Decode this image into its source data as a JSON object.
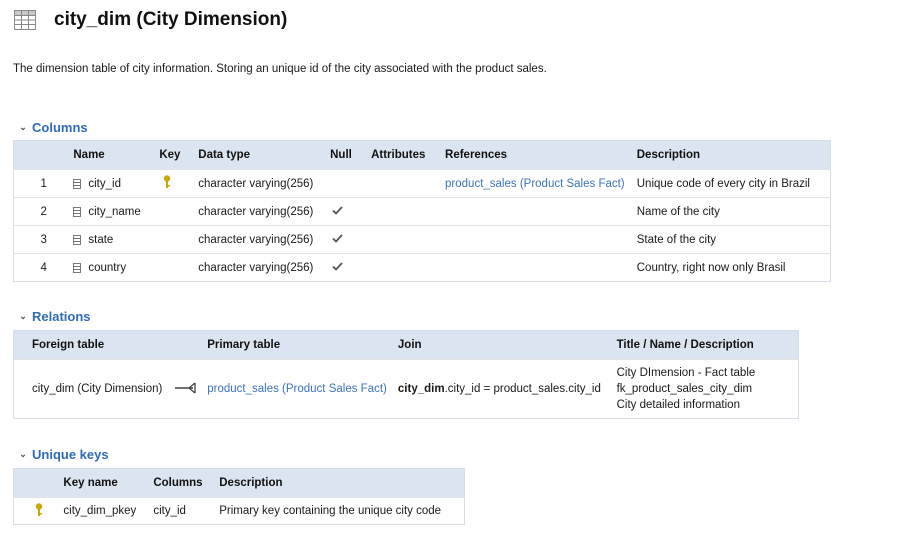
{
  "header": {
    "title": "city_dim (City Dimension)"
  },
  "description": "The dimension table of city information. Storing an unique id of the city associated with the product sales.",
  "columns_section": {
    "title": "Columns",
    "headers": {
      "name": "Name",
      "key": "Key",
      "data_type": "Data type",
      "null": "Null",
      "attributes": "Attributes",
      "references": "References",
      "description": "Description"
    },
    "rows": [
      {
        "num": "1",
        "name": "city_id",
        "key": true,
        "data_type": "character varying(256)",
        "null": false,
        "attributes": "",
        "references": "product_sales (Product Sales Fact)",
        "description": "Unique code of every city in Brazil"
      },
      {
        "num": "2",
        "name": "city_name",
        "key": false,
        "data_type": "character varying(256)",
        "null": true,
        "attributes": "",
        "references": "",
        "description": "Name of the city"
      },
      {
        "num": "3",
        "name": "state",
        "key": false,
        "data_type": "character varying(256)",
        "null": true,
        "attributes": "",
        "references": "",
        "description": "State of the city"
      },
      {
        "num": "4",
        "name": "country",
        "key": false,
        "data_type": "character varying(256)",
        "null": true,
        "attributes": "",
        "references": "",
        "description": "Country, right now only Brasil"
      }
    ]
  },
  "relations_section": {
    "title": "Relations",
    "headers": {
      "foreign_table": "Foreign table",
      "primary_table": "Primary table",
      "join": "Join",
      "title_desc": "Title / Name / Description"
    },
    "rows": [
      {
        "foreign_table": "city_dim (City Dimension)",
        "primary_table": "product_sales (Product Sales Fact)",
        "join_bold": "city_dim",
        "join_rest": ".city_id = product_sales.city_id",
        "title": "City DImension - Fact table",
        "name": "fk_product_sales_city_dim",
        "description": "City detailed information"
      }
    ]
  },
  "unique_keys_section": {
    "title": "Unique keys",
    "headers": {
      "key_name": "Key name",
      "columns": "Columns",
      "description": "Description"
    },
    "rows": [
      {
        "key_name": "city_dim_pkey",
        "columns": "city_id",
        "description": "Primary key containing the unique city code"
      }
    ]
  },
  "colors": {
    "accent": "#2e6cb5",
    "header_bg": "#dbe5f1",
    "link": "#3d73b8",
    "key_icon": "#c9a800"
  }
}
